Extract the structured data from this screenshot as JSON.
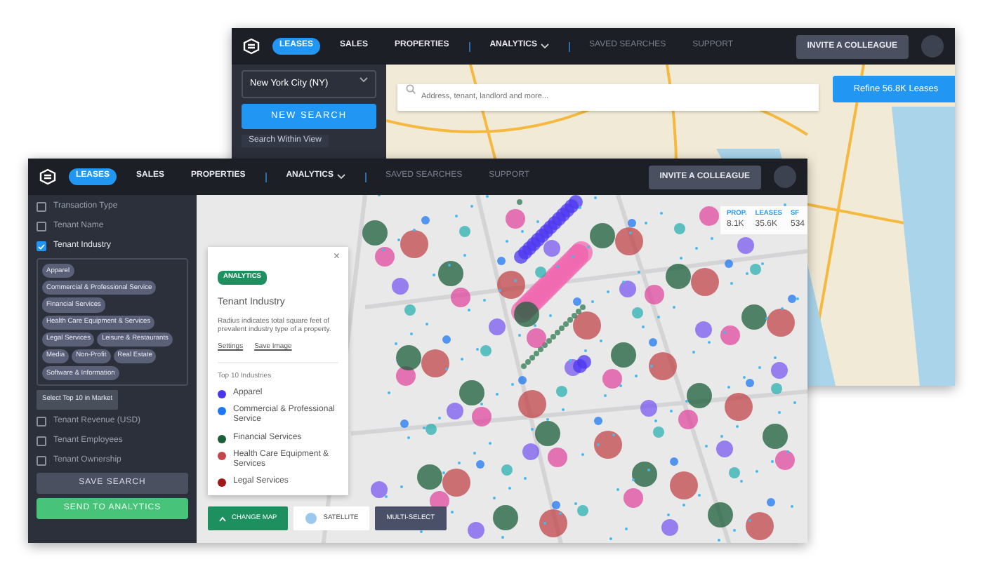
{
  "back_window": {
    "nav": {
      "tabs": [
        {
          "label": "LEASES",
          "selected": true,
          "dimmed": false,
          "kind": "link"
        },
        {
          "label": "SALES",
          "selected": false,
          "dimmed": false,
          "kind": "link"
        },
        {
          "label": "PROPERTIES",
          "selected": false,
          "dimmed": false,
          "kind": "link"
        },
        {
          "label": "ANALYTICS",
          "selected": false,
          "dimmed": false,
          "kind": "dropdown"
        },
        {
          "label": "SAVED SEARCHES",
          "selected": false,
          "dimmed": true,
          "kind": "link"
        },
        {
          "label": "SUPPORT",
          "selected": false,
          "dimmed": true,
          "kind": "link"
        }
      ],
      "invite_button": "INVITE A COLLEAGUE"
    },
    "market_select": "New York City (NY)",
    "new_search_button": "NEW SEARCH",
    "search_within_view": "Search Within View",
    "search": {
      "placeholder": "Address, tenant, landlord and more..."
    },
    "refine_button": "Refine 56.8K Leases"
  },
  "front_window": {
    "nav": {
      "tabs": [
        {
          "label": "LEASES",
          "selected": true,
          "dimmed": false,
          "kind": "link"
        },
        {
          "label": "SALES",
          "selected": false,
          "dimmed": false,
          "kind": "link"
        },
        {
          "label": "PROPERTIES",
          "selected": false,
          "dimmed": false,
          "kind": "link"
        },
        {
          "label": "ANALYTICS",
          "selected": false,
          "dimmed": false,
          "kind": "dropdown"
        },
        {
          "label": "SAVED SEARCHES",
          "selected": false,
          "dimmed": true,
          "kind": "link"
        },
        {
          "label": "SUPPORT",
          "selected": false,
          "dimmed": true,
          "kind": "link"
        }
      ],
      "invite_button": "INVITE A COLLEAGUE"
    },
    "filters": [
      {
        "label": "Transaction Type",
        "checked": false
      },
      {
        "label": "Tenant Name",
        "checked": false
      },
      {
        "label": "Tenant Industry",
        "checked": true,
        "tags": [
          "Apparel",
          "Commercial & Professional Service",
          "Financial Services",
          "Health Care Equipment & Services",
          "Legal Services",
          "Leisure & Restaurants",
          "Media",
          "Non-Profit",
          "Real Estate",
          "Software & Information"
        ],
        "action_button": "Select Top 10 in Market"
      },
      {
        "label": "Tenant Revenue (USD)",
        "checked": false
      },
      {
        "label": "Tenant Employees",
        "checked": false
      },
      {
        "label": "Tenant Ownership",
        "checked": false
      }
    ],
    "save_search_button": "SAVE SEARCH",
    "send_button": "SEND TO ANALYTICS",
    "stats": [
      {
        "label": "PROP.",
        "value": "8.1K"
      },
      {
        "label": "LEASES",
        "value": "35.6K"
      },
      {
        "label": "SF",
        "value": "534"
      }
    ],
    "analytics_panel": {
      "badge": "ANALYTICS",
      "close": "×",
      "title": "Tenant Industry",
      "description": "Radius indicates total square feet of prevalent industry type of a property.",
      "links": [
        "Settings",
        "Save Image"
      ],
      "legend_title": "Top 10 Industries",
      "legend": [
        {
          "label": "Apparel",
          "color": "#4b36f0"
        },
        {
          "label": "Commercial & Professional Service",
          "color": "#1f78f2"
        },
        {
          "label": "Financial Services",
          "color": "#1b5e3a"
        },
        {
          "label": "Health Care Equipment & Services",
          "color": "#c2464a"
        },
        {
          "label": "Legal Services",
          "color": "#a01818"
        }
      ]
    },
    "map_buttons": [
      {
        "label": "CHANGE MAP",
        "kind": "primary"
      },
      {
        "label": "SATELLITE",
        "kind": "globe"
      },
      {
        "label": "MULTI-SELECT",
        "kind": "plain"
      }
    ]
  }
}
